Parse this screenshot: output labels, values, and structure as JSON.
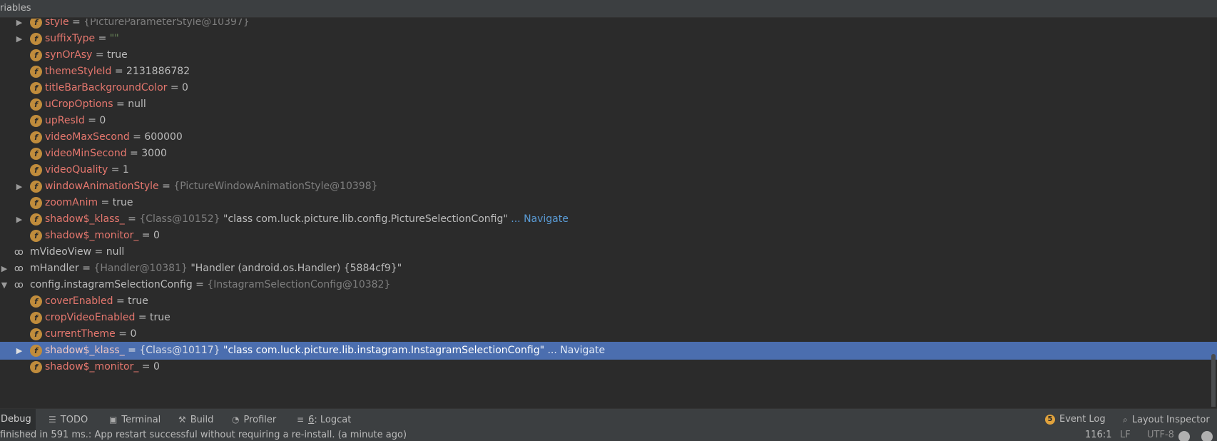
{
  "header": {
    "title": "riables"
  },
  "rows": [
    {
      "name": "style",
      "eq": " = ",
      "ref": "{PictureParameterStyle@10397}"
    },
    {
      "name": "suffixType",
      "eq": " = ",
      "str": "\"\""
    },
    {
      "name": "synOrAsy",
      "eq": " = ",
      "val": "true"
    },
    {
      "name": "themeStyleId",
      "eq": " = ",
      "val": "2131886782"
    },
    {
      "name": "titleBarBackgroundColor",
      "eq": " = ",
      "val": "0"
    },
    {
      "name": "uCropOptions",
      "eq": " = ",
      "val": "null"
    },
    {
      "name": "upResId",
      "eq": " = ",
      "val": "0"
    },
    {
      "name": "videoMaxSecond",
      "eq": " = ",
      "val": "600000"
    },
    {
      "name": "videoMinSecond",
      "eq": " = ",
      "val": "3000"
    },
    {
      "name": "videoQuality",
      "eq": " = ",
      "val": "1"
    },
    {
      "name": "windowAnimationStyle",
      "eq": " = ",
      "ref": "{PictureWindowAnimationStyle@10398}"
    },
    {
      "name": "zoomAnim",
      "eq": " = ",
      "val": "true"
    },
    {
      "name": "shadow$_klass_",
      "eq": " = ",
      "ref": "{Class@10152}",
      "strw": " \"class com.luck.picture.lib.config.PictureSelectionConfig\"",
      "nav": " ... Navigate"
    },
    {
      "name": "shadow$_monitor_",
      "eq": " = ",
      "val": "0"
    },
    {
      "name": "mVideoView",
      "eq": " = ",
      "val": "null"
    },
    {
      "name": "mHandler",
      "eq": " = ",
      "ref": "{Handler@10381}",
      "strw": " \"Handler (android.os.Handler) {5884cf9}\""
    },
    {
      "name": "config.instagramSelectionConfig",
      "eq": " = ",
      "ref": "{InstagramSelectionConfig@10382}"
    },
    {
      "name": "coverEnabled",
      "eq": " = ",
      "val": "true"
    },
    {
      "name": "cropVideoEnabled",
      "eq": " = ",
      "val": "true"
    },
    {
      "name": "currentTheme",
      "eq": " = ",
      "val": "0"
    },
    {
      "name": "shadow$_klass_",
      "eq": " = ",
      "ref": "{Class@10117}",
      "strw": " \"class com.luck.picture.lib.instagram.InstagramSelectionConfig\"",
      "nav": " ... Navigate"
    },
    {
      "name": "shadow$_monitor_",
      "eq": " = ",
      "val": "0"
    }
  ],
  "toolbar": {
    "debug": "Debug",
    "todo": "TODO",
    "terminal": "Terminal",
    "build": "Build",
    "profiler": "Profiler",
    "logcat_num": "6",
    "logcat": ": Logcat",
    "event_count": "5",
    "event_log": "Event Log",
    "layout_inspector": "Layout Inspector"
  },
  "status": {
    "message": "finished in 591 ms.: App restart successful without requiring a re-install. (a minute ago)",
    "position": "116:1",
    "line_sep": "LF",
    "encoding": "UTF-8"
  },
  "colors": {
    "background": "#2b2b2b",
    "selection": "#4b6eaf",
    "field_name": "#e5776e",
    "field_badge": "#c08c3c",
    "string_value": "#6a8759",
    "navigate_link": "#5a9bd5"
  }
}
